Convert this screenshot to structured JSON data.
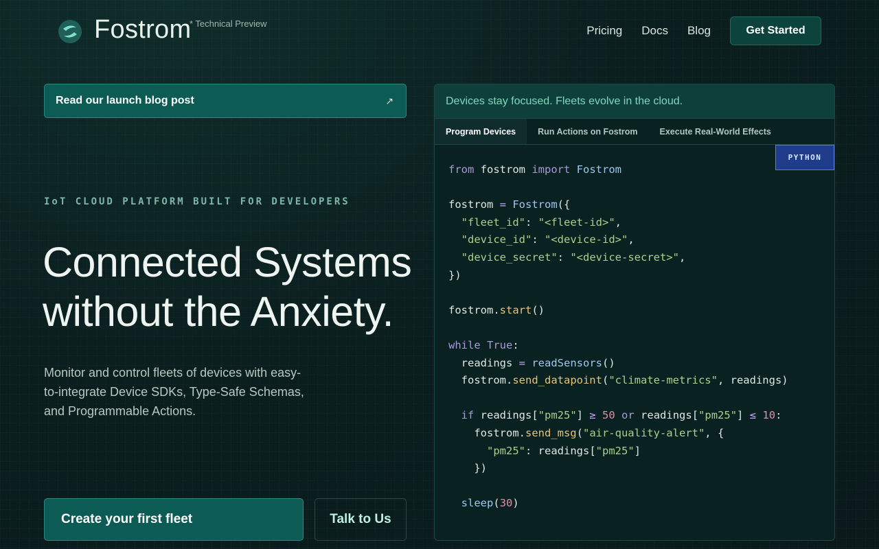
{
  "header": {
    "brand": "Fostrom",
    "preview_tag": "* Technical Preview",
    "nav": [
      "Pricing",
      "Docs",
      "Blog"
    ],
    "cta": "Get Started"
  },
  "hero": {
    "launch_link": "Read our launch blog post",
    "eyebrow": "IoT CLOUD PLATFORM BUILT FOR DEVELOPERS",
    "headline_line1": "Connected Systems",
    "headline_line2": "without the Anxiety.",
    "subtext": "Monitor and control fleets of devices with easy-to-integrate Device SDKs, Type-Safe Schemas, and Programmable Actions.",
    "primary_cta": "Create your first fleet",
    "secondary_cta": "Talk to Us"
  },
  "code_panel": {
    "tagline": "Devices stay focused. Fleets evolve in the cloud.",
    "tabs": [
      "Program Devices",
      "Run Actions on Fostrom",
      "Execute Real-World Effects"
    ],
    "active_tab": "Program Devices",
    "language": "PYTHON"
  },
  "colors": {
    "accent": "#0c5c55",
    "accent_text": "#7fd7bd",
    "background": "#0b1f1f"
  }
}
